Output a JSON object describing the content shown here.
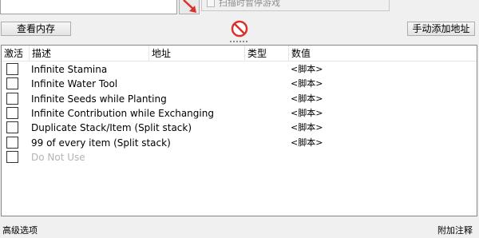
{
  "scan": {
    "pause_game_label": "扫描时暂停游戏"
  },
  "toolbar": {
    "view_memory_label": "查看内存",
    "add_address_label": "手动添加地址"
  },
  "icons": {
    "pointer": "red-diagonal-arrow-icon",
    "stop": "prohibited-icon"
  },
  "colors": {
    "accent_red": "#d9302c"
  },
  "table": {
    "columns": [
      "激活",
      "描述",
      "地址",
      "类型",
      "数值"
    ],
    "rows": [
      {
        "active": false,
        "description": "Infinite Stamina",
        "value": "<脚本>"
      },
      {
        "active": false,
        "description": "Infinite Water Tool",
        "value": "<脚本>"
      },
      {
        "active": false,
        "description": "Infinite Seeds while Planting",
        "value": "<脚本>"
      },
      {
        "active": false,
        "description": "Infinite Contribution while Exchanging",
        "value": "<脚本>"
      },
      {
        "active": false,
        "description": "Duplicate Stack/Item (Split stack)",
        "value": "<脚本>"
      },
      {
        "active": false,
        "description": "99 of every item (Split stack)",
        "value": "<脚本>"
      },
      {
        "active": false,
        "description": "Do Not Use",
        "value": ""
      }
    ]
  },
  "footer": {
    "advanced_options_label": "高级选项",
    "table_extras_label": "附加注释"
  }
}
